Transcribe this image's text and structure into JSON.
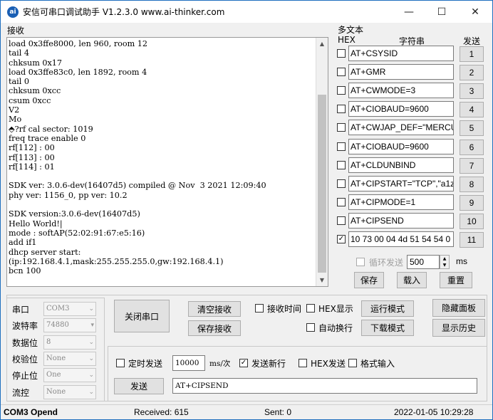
{
  "window": {
    "title": "安信可串口调试助手 V1.2.3.0    www.ai-thinker.com",
    "icon_text": "ai",
    "controls": [
      "minimize-icon",
      "maximize-icon",
      "close-icon"
    ]
  },
  "receive": {
    "label": "接收",
    "text": "load 0x3ffe8000, len 960, room 12\ntail 4\nchksum 0x17\nload 0x3ffe83c0, len 1892, room 4\ntail 0\nchksum 0xcc\ncsum 0xcc\nV2\nMo\n⬘?rf cal sector: 1019\nfreq trace enable 0\nrf[112] : 00\nrf[113] : 00\nrf[114] : 01\n\nSDK ver: 3.0.6-dev(16407d5) compiled @ Nov  3 2021 12:09:40\nphy ver: 1156_0, pp ver: 10.2\n\nSDK version:3.0.6-dev(16407d5)\nHello World!|\nmode : softAP(52:02:91:67:e5:16)\nadd if1\ndhcp server start:\n(ip:192.168.4.1,mask:255.255.255.0,gw:192.168.4.1)\nbcn 100"
  },
  "multitext": {
    "title": "多文本",
    "headers": {
      "hex": "HEX",
      "string": "字符串",
      "send": "发送"
    },
    "rows": [
      {
        "checked": false,
        "text": "AT+CSYSID",
        "num": "1"
      },
      {
        "checked": false,
        "text": "AT+GMR",
        "num": "2"
      },
      {
        "checked": false,
        "text": "AT+CWMODE=3",
        "num": "3"
      },
      {
        "checked": false,
        "text": "AT+CIOBAUD=9600",
        "num": "4"
      },
      {
        "checked": false,
        "text": "AT+CWJAP_DEF=\"MERCU",
        "num": "5"
      },
      {
        "checked": false,
        "text": "AT+CIOBAUD=9600",
        "num": "6"
      },
      {
        "checked": false,
        "text": "AT+CLDUNBIND",
        "num": "7"
      },
      {
        "checked": false,
        "text": "AT+CIPSTART=\"TCP\",\"a1z",
        "num": "8"
      },
      {
        "checked": false,
        "text": "AT+CIPMODE=1",
        "num": "9"
      },
      {
        "checked": false,
        "text": "AT+CIPSEND",
        "num": "10"
      },
      {
        "checked": true,
        "text": "10 73 00 04 4d 51 54 54 0",
        "num": "11"
      }
    ],
    "loop_label": "循环发送",
    "loop_value": "500",
    "loop_unit": "ms",
    "save": "保存",
    "load": "载入",
    "reset": "重置"
  },
  "serial": {
    "port_label": "串口",
    "port_value": "COM3",
    "baud_label": "波特率",
    "baud_value": "74880",
    "databits_label": "数据位",
    "databits_value": "8",
    "parity_label": "校验位",
    "parity_value": "None",
    "stopbits_label": "停止位",
    "stopbits_value": "One",
    "flow_label": "流控",
    "flow_value": "None"
  },
  "controls": {
    "close_port": "关闭串口",
    "clear_recv": "清空接收",
    "save_recv": "保存接收",
    "recv_time": "接收时间",
    "hex_display": "HEX显示",
    "run_mode": "运行模式",
    "hide_panel": "隐藏面板",
    "auto_wrap": "自动换行",
    "download_mode": "下载模式",
    "show_history": "显示历史"
  },
  "send": {
    "timed_send": "定时发送",
    "interval": "10000",
    "unit": "ms/次",
    "newline": "发送新行",
    "newline_checked": true,
    "hex_send": "HEX发送",
    "format_input": "格式输入",
    "send_button": "发送",
    "input_value": "AT+CIPSEND"
  },
  "status": {
    "port_state": "COM3 Opend",
    "received": "Received: 615",
    "sent": "Sent: 0",
    "datetime": "2022-01-05 10:29:28"
  }
}
